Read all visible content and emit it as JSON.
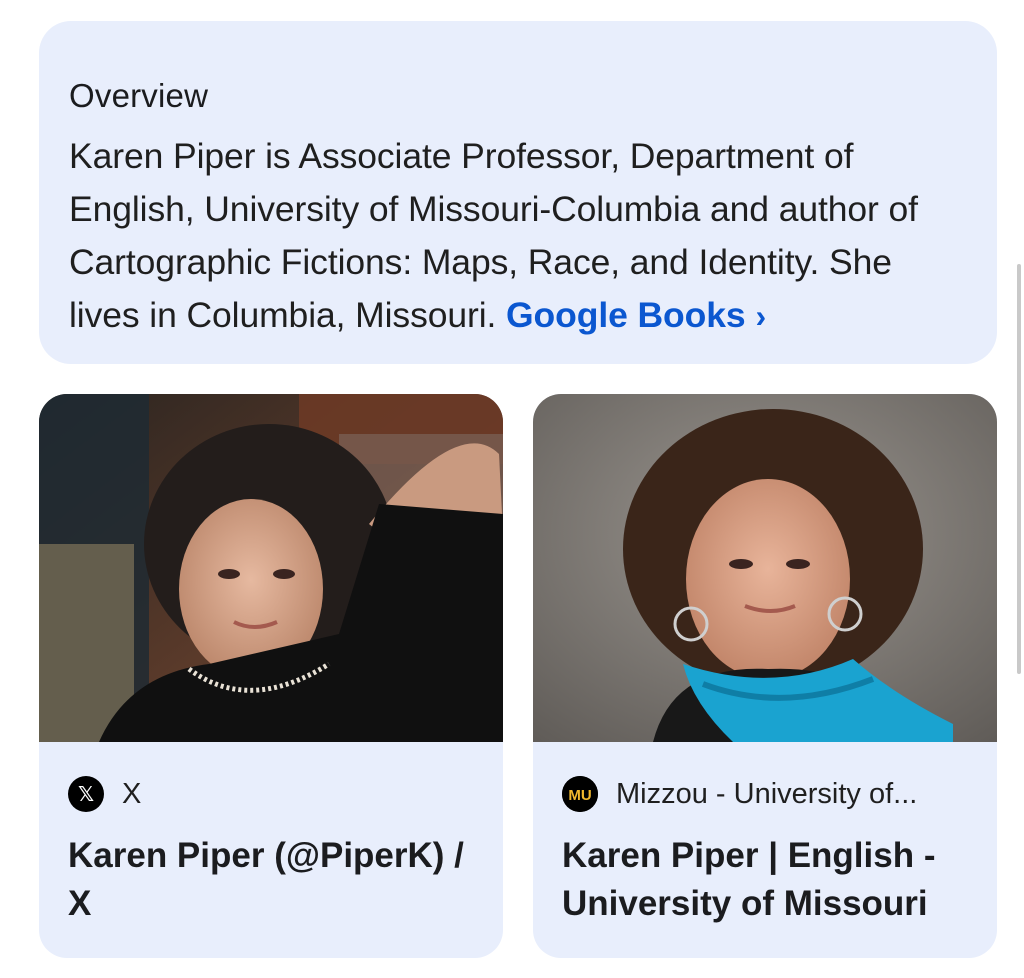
{
  "overview": {
    "heading": "Overview",
    "description": "Karen Piper is Associate Professor, Department of English, University of Missouri-Columbia and author of Cartographic Fictions: Maps, Race, and Identity. She lives in Columbia, Missouri.",
    "source_link": "Google Books",
    "chevron": "›"
  },
  "results": [
    {
      "source_name": "X",
      "favicon": "x-logo-icon",
      "favicon_glyph": "𝕏",
      "title": "Karen Piper (@PiperK) / X",
      "image": "portrait-photo"
    },
    {
      "source_name": "Mizzou - University of...",
      "favicon": "mizzou-logo-icon",
      "favicon_glyph": "MU",
      "title": "Karen Piper | English - University of Missouri",
      "image": "portrait-photo"
    }
  ],
  "colors": {
    "card_background": "#e8eefc",
    "link": "#0b57d0",
    "text": "#1f1f1f"
  }
}
